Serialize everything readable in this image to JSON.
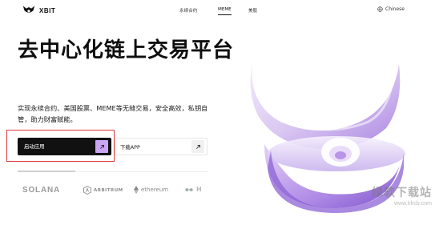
{
  "header": {
    "brand": "XBIT",
    "nav": [
      {
        "label": "永续合约",
        "active": false
      },
      {
        "label": "MEME",
        "active": true
      },
      {
        "label": "美股",
        "active": false
      }
    ],
    "language": "Chinese"
  },
  "hero": {
    "title": "去中心化链上交易平台",
    "description": "实现永续合约、美国股票、MEME等无缝交易，安全高效，私钥自管，助力财富赋能。",
    "primary_button": "启动应用",
    "secondary_button": "下载APP"
  },
  "partners": [
    "SOLANA",
    "ARBITRUM",
    "ethereum",
    "H"
  ],
  "watermark": {
    "title": "绿软下载站",
    "url": "www.lrlrcb.com"
  },
  "colors": {
    "accent": "#c9a6f2",
    "highlight_border": "#e0383a",
    "button_dark": "#111111"
  },
  "icons": [
    "logo-mark",
    "globe-icon",
    "arrow-up-right-icon",
    "arbitrum-icon",
    "ethereum-icon",
    "hyperliquid-icon"
  ]
}
